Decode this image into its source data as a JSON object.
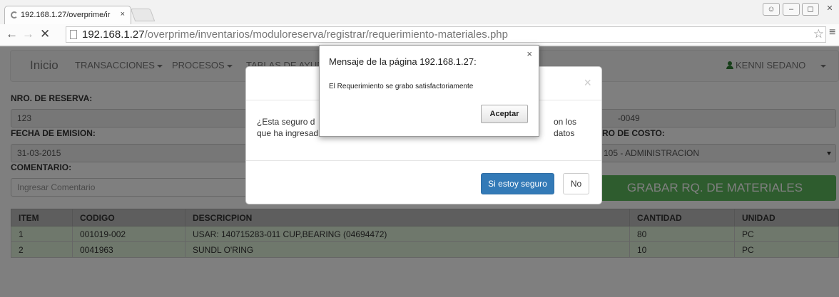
{
  "browser": {
    "tab_title": "192.168.1.27/overprime/ir",
    "tab_close": "×",
    "url_host": "192.168.1.27",
    "url_path": "/overprime/inventarios/moduloreserva/registrar/requerimiento-materiales.php"
  },
  "navbar": {
    "brand": "Inicio",
    "menus": [
      "TRANSACCIONES",
      "PROCESOS",
      "TABLAS DE AYUD"
    ],
    "user": "KENNI SEDANO"
  },
  "form": {
    "reserva_label": "NRO. DE RESERVA:",
    "reserva_value": "123",
    "fecha_label": "FECHA DE EMISION:",
    "fecha_value": "31-03-2015",
    "comentario_label": "COMENTARIO:",
    "comentario_placeholder": "Ingresar Comentario",
    "right_value": "-0049",
    "centro_label": "RO DE COSTO:",
    "centro_value": "105 - ADMINISTRACION",
    "grabar_button": "GRABAR RQ. DE MATERIALES"
  },
  "table": {
    "headers": [
      "ITEM",
      "CODIGO",
      "DESCRICPION",
      "CANTIDAD",
      "UNIDAD"
    ],
    "rows": [
      [
        "1",
        "001019-002",
        "USAR: 140715283-011 CUP,BEARING (04694472)",
        "80",
        "PC"
      ],
      [
        "2",
        "0041963",
        "SUNDL O'RING",
        "10",
        "PC"
      ]
    ]
  },
  "modal": {
    "close": "×",
    "body_line1_start": "¿Esta seguro d",
    "body_line1_end": "on los datos",
    "body_line2": "que ha ingresad",
    "confirm_button": "Si estoy seguro",
    "cancel_button": "No"
  },
  "alert": {
    "title": "Mensaje de la página 192.168.1.27:",
    "message": "El Requerimiento  se grabo satisfactoriamente",
    "accept_button": "Aceptar",
    "close": "×"
  }
}
